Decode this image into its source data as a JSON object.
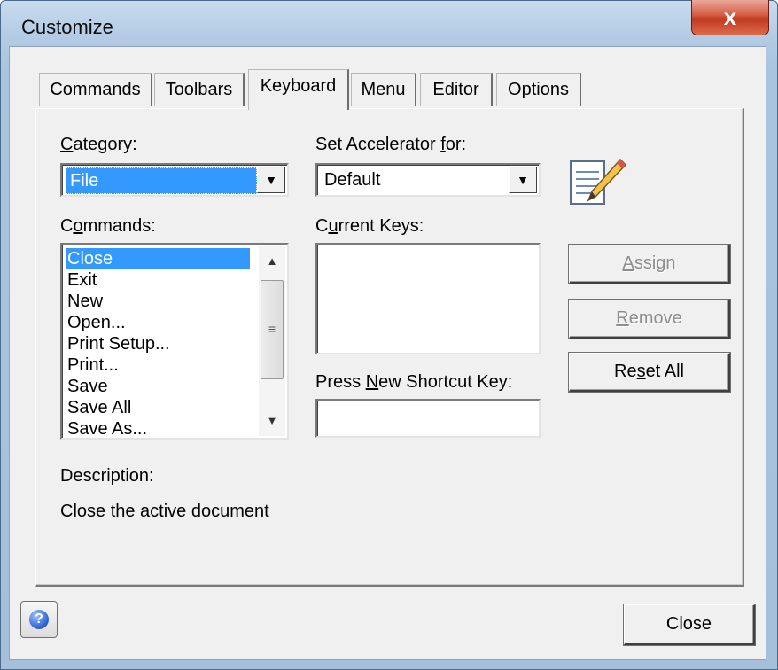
{
  "window": {
    "title": "Customize",
    "close_glyph": "x"
  },
  "tabs": [
    {
      "label": "Commands"
    },
    {
      "label": "Toolbars"
    },
    {
      "label": "Keyboard",
      "active": true
    },
    {
      "label": "Menu"
    },
    {
      "label": "Editor"
    },
    {
      "label": "Options"
    }
  ],
  "keyboard": {
    "category_label": "Category:",
    "category_value": "File",
    "set_accelerator_label": "Set Accelerator for:",
    "set_accelerator_value": "Default",
    "commands_label": "Commands:",
    "commands": [
      "Close",
      "Exit",
      "New",
      "Open...",
      "Print Setup...",
      "Print...",
      "Save",
      "Save All",
      "Save As..."
    ],
    "selected_command": "Close",
    "current_keys_label": "Current Keys:",
    "current_keys": [],
    "press_new_label": "Press New Shortcut Key:",
    "new_shortcut_value": "",
    "assign_label": "Assign",
    "remove_label": "Remove",
    "reset_all_label": "Reset All",
    "description_label": "Description:",
    "description_text": "Close the active document"
  },
  "footer": {
    "close_label": "Close",
    "help_glyph": "?"
  },
  "icons": {
    "notepad": "notepad-pencil-icon",
    "help": "help-icon"
  },
  "colors": {
    "selection": "#3399ff",
    "title_bar": "#b3cbe4",
    "close_button": "#c03a21"
  }
}
